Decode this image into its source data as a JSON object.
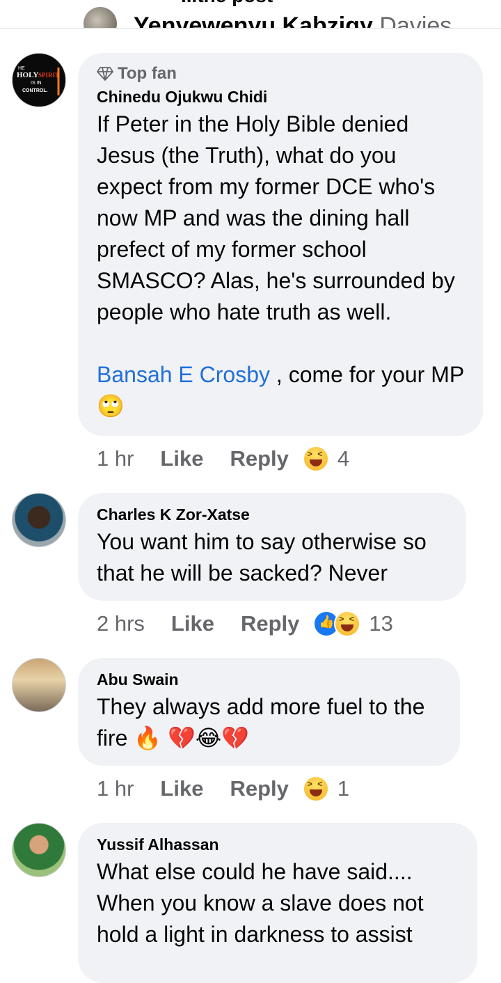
{
  "header": {
    "partial_title": "...the post",
    "partial_author": "Yenyewenyu Kabzigy",
    "partial_author_suffix": "Davies ..."
  },
  "comments": [
    {
      "badge": "Top fan",
      "author": "Chinedu Ojukwu Chidi",
      "text": "If Peter in the Holy Bible denied Jesus (the Truth), what do you expect from my former DCE who's now MP and was the dining hall prefect of my former school SMASCO? Alas, he's surrounded by people who hate truth as well.",
      "mention": "Bansah E Crosby",
      "after_mention": " , come for your MP🙄",
      "time": "1 hr",
      "like_label": "Like",
      "reply_label": "Reply",
      "reaction_count": "4",
      "avatar_text": "THE HOLY SPIRIT IS IN CONTROL."
    },
    {
      "author": "Charles K Zor-Xatse",
      "text": "You want him to say otherwise so that he will be sacked? Never",
      "time": "2 hrs",
      "like_label": "Like",
      "reply_label": "Reply",
      "reaction_count": "13"
    },
    {
      "author": "Abu Swain",
      "text": "They always add more fuel to the fire 🔥 💔😂💔",
      "time": "1 hr",
      "like_label": "Like",
      "reply_label": "Reply",
      "reaction_count": "1"
    },
    {
      "author": "Yussif Alhassan",
      "text": "What else could he have said....\nWhen you know a slave does not hold a light in darkness to assist"
    }
  ]
}
